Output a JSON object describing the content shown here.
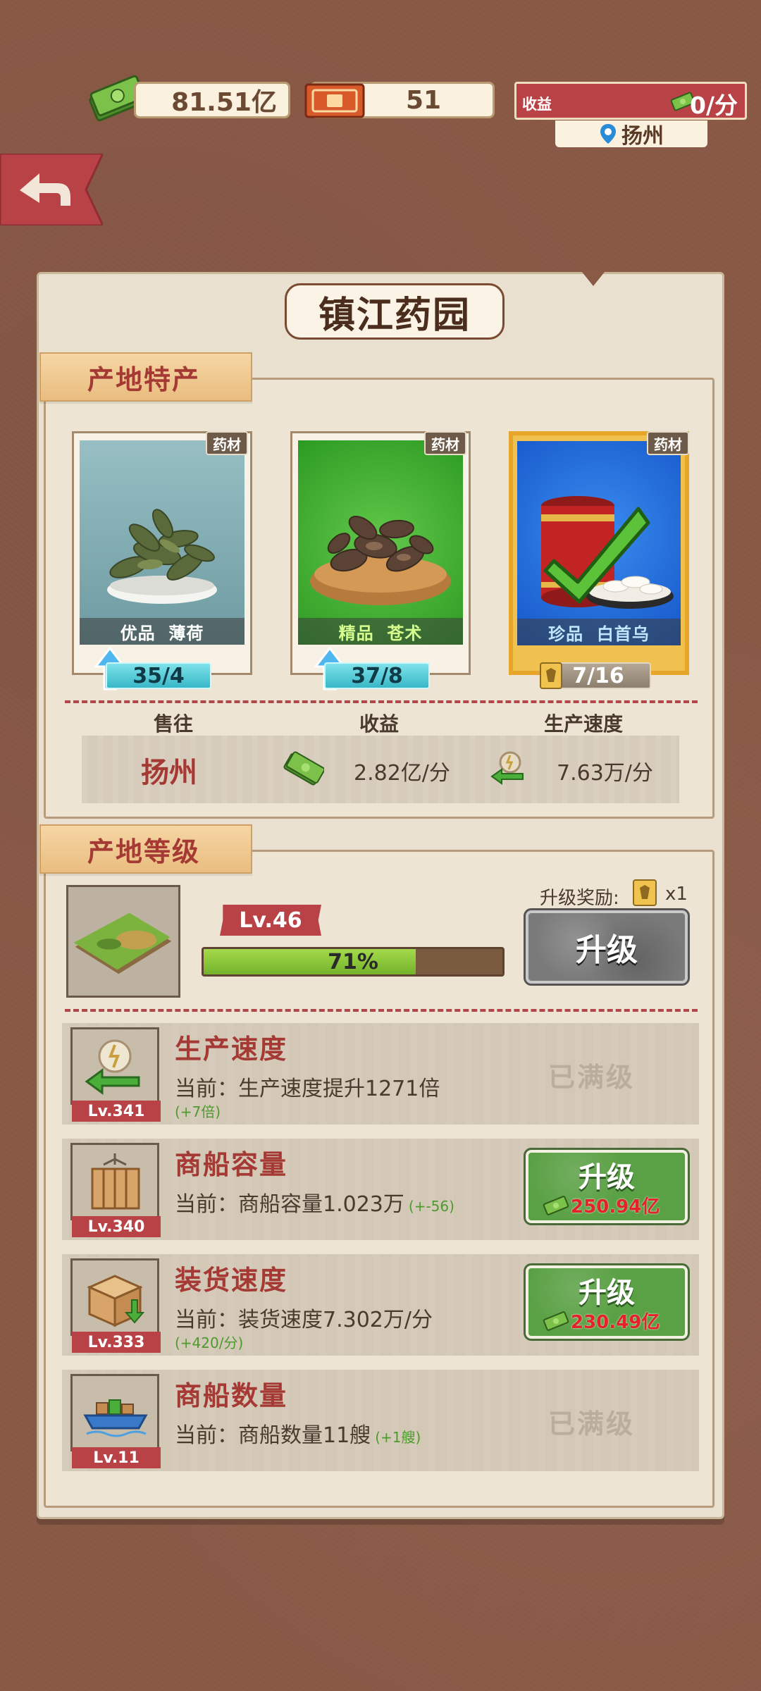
{
  "top_bar": {
    "money": "81.51亿",
    "tickets": "51",
    "income_label": "收益",
    "income_value": "0/分",
    "location": "扬州"
  },
  "panel": {
    "title": "镇江药园",
    "specialty_tab": "产地特产",
    "products": [
      {
        "tag": "药材",
        "quality": "优品",
        "name": "薄荷",
        "count": "35/4",
        "icon": "mint-leaves-image"
      },
      {
        "tag": "药材",
        "quality": "精品",
        "name": "苍术",
        "count": "37/8",
        "icon": "atractylodes-image"
      },
      {
        "tag": "药材",
        "quality": "珍品",
        "name": "白首乌",
        "count": "7/16",
        "icon": "baishouwu-jar-image"
      }
    ],
    "stats": {
      "sell_to_label": "售往",
      "income_label": "收益",
      "speed_label": "生产速度",
      "destination": "扬州",
      "income_value": "2.82亿/分",
      "speed_value": "7.63万/分"
    },
    "level_tab": "产地等级",
    "level": {
      "badge": "Lv.46",
      "progress_text": "71%",
      "progress_percent": 71,
      "reward_label": "升级奖励:",
      "reward_count": "x1",
      "upgrade_label": "升级"
    },
    "upgrades": [
      {
        "lv": "Lv.341",
        "title": "生产速度",
        "desc": "当前：生产速度提升1271倍",
        "bonus": "(+7倍)",
        "maxed": "已满级"
      },
      {
        "lv": "Lv.340",
        "title": "商船容量",
        "desc": "当前：商船容量1.023万",
        "bonus": "(+-56)",
        "button": "升级",
        "cost": "250.94亿"
      },
      {
        "lv": "Lv.333",
        "title": "装货速度",
        "desc": "当前：装货速度7.302万/分",
        "bonus": "(+420/分)",
        "button": "升级",
        "cost": "230.49亿"
      },
      {
        "lv": "Lv.11",
        "title": "商船数量",
        "desc": "当前：商船数量11艘",
        "bonus": "(+1艘)",
        "maxed": "已满级"
      }
    ]
  },
  "colors": {
    "background": "#8a5a47",
    "accent_red": "#b84246",
    "panel": "#eae0cf",
    "upgrade_green": "#5aa044"
  }
}
